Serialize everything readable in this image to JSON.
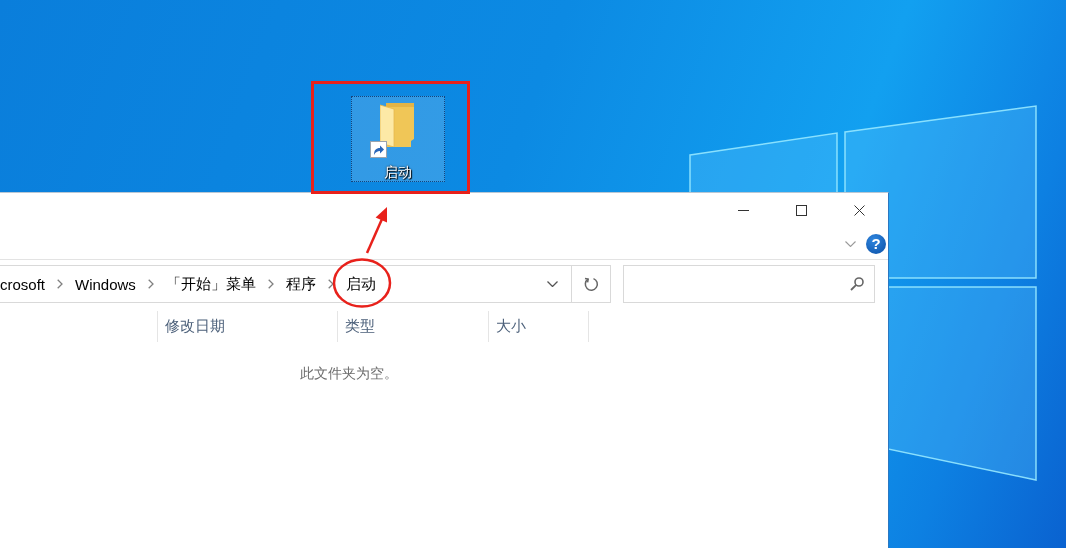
{
  "desktop_icon": {
    "label": "启动",
    "selected": true
  },
  "explorer": {
    "help": "?",
    "address": {
      "crumbs": [
        "crosoft",
        "Windows",
        "「开始」菜单",
        "程序",
        "启动"
      ]
    },
    "columns": [
      "修改日期",
      "类型",
      "大小"
    ],
    "empty_message": "此文件夹为空。"
  }
}
